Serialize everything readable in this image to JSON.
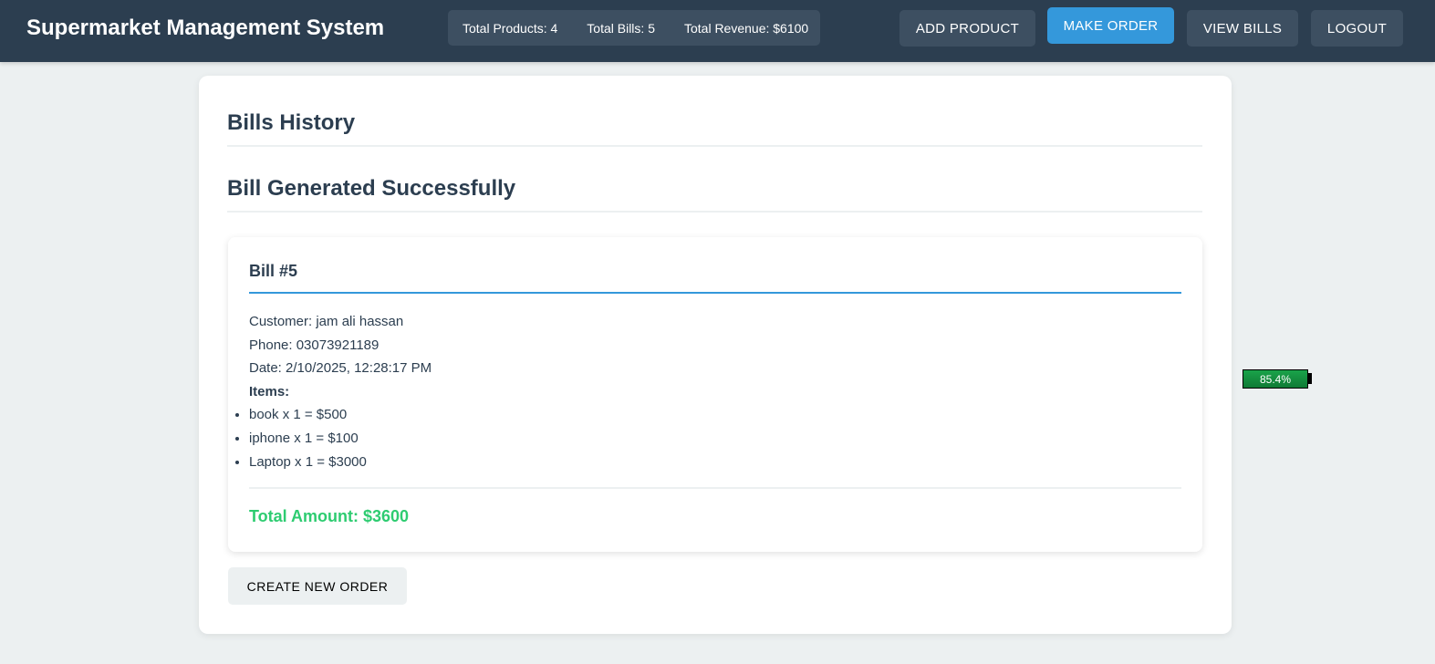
{
  "navbar": {
    "brand": "Supermarket Management System",
    "stats": {
      "total_products": "Total Products: 4",
      "total_bills": "Total Bills: 5",
      "total_revenue": "Total Revenue: $6100"
    },
    "buttons": {
      "add_product": "ADD PRODUCT",
      "make_order": "MAKE ORDER",
      "view_bills": "VIEW BILLS",
      "logout": "LOGOUT"
    }
  },
  "main": {
    "title": "Bills History",
    "subtitle": "Bill Generated Successfully",
    "bill": {
      "header": "Bill #5",
      "customer": "Customer: jam ali hassan",
      "phone": "Phone: 03073921189",
      "date": "Date: 2/10/2025, 12:28:17 PM",
      "items_label": "Items:",
      "items": [
        "book x 1 = $500",
        "iphone x 1 = $100",
        "Laptop x 1 = $3000"
      ],
      "total": "Total Amount: $3600"
    },
    "create_new_order": "CREATE NEW ORDER"
  },
  "battery": {
    "label": "85.4%",
    "level": 0.854
  },
  "colors": {
    "navbar_bg": "#2c3e50",
    "accent": "#3498db",
    "total_green": "#2ecc71",
    "page_bg": "#ecf0f1"
  }
}
